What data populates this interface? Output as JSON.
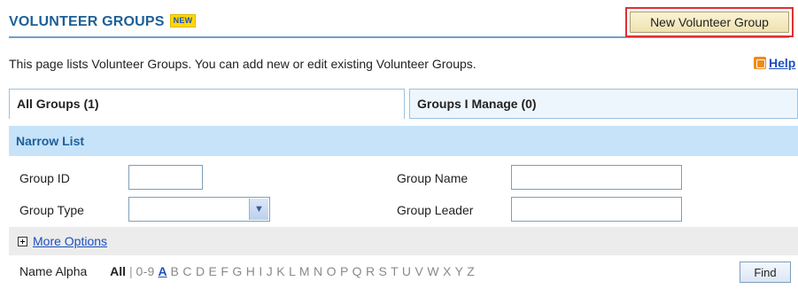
{
  "header": {
    "title": "VOLUNTEER GROUPS",
    "new_badge": "NEW",
    "new_button_label": "New Volunteer Group"
  },
  "description": "This page lists Volunteer Groups. You can add new or edit existing Volunteer Groups.",
  "help": {
    "label": "Help",
    "icon": "help-icon"
  },
  "tabs": [
    {
      "label": "All Groups (1)",
      "selected": true
    },
    {
      "label": "Groups I Manage (0)",
      "selected": false
    }
  ],
  "narrow_list": {
    "title": "Narrow List",
    "group_id_label": "Group ID",
    "group_id_value": "",
    "group_name_label": "Group Name",
    "group_name_value": "",
    "group_type_label": "Group Type",
    "group_type_selected": "",
    "group_leader_label": "Group Leader",
    "group_leader_value": "",
    "more_options_label": "More Options"
  },
  "alpha_filter": {
    "label": "Name Alpha",
    "all_label": "All",
    "separator": "|",
    "digits_label": "0-9",
    "active_letter": "A",
    "other_letters": "B C D E F G H I J K L M N O P Q R S T U V W X Y Z",
    "find_label": "Find"
  },
  "colors": {
    "title": "#1d5f97",
    "link": "#1d4fbf",
    "narrow_bar": "#c6e3fa",
    "highlight_border": "#e03030"
  }
}
